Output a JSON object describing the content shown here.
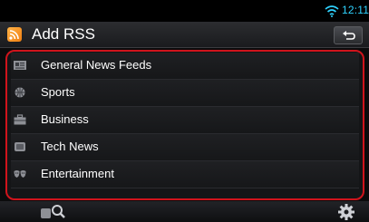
{
  "status_bar": {
    "time": "12:11"
  },
  "header": {
    "title": "Add RSS"
  },
  "list": {
    "items": [
      {
        "label": "General News Feeds",
        "icon": "newspaper-icon"
      },
      {
        "label": "Sports",
        "icon": "ball-icon"
      },
      {
        "label": "Business",
        "icon": "briefcase-icon"
      },
      {
        "label": "Tech News",
        "icon": "tech-icon"
      },
      {
        "label": "Entertainment",
        "icon": "mask-icon"
      }
    ]
  },
  "colors": {
    "accent": "#2fd3ff",
    "highlight_border": "#d0141c",
    "rss_orange": "#f07f12"
  }
}
